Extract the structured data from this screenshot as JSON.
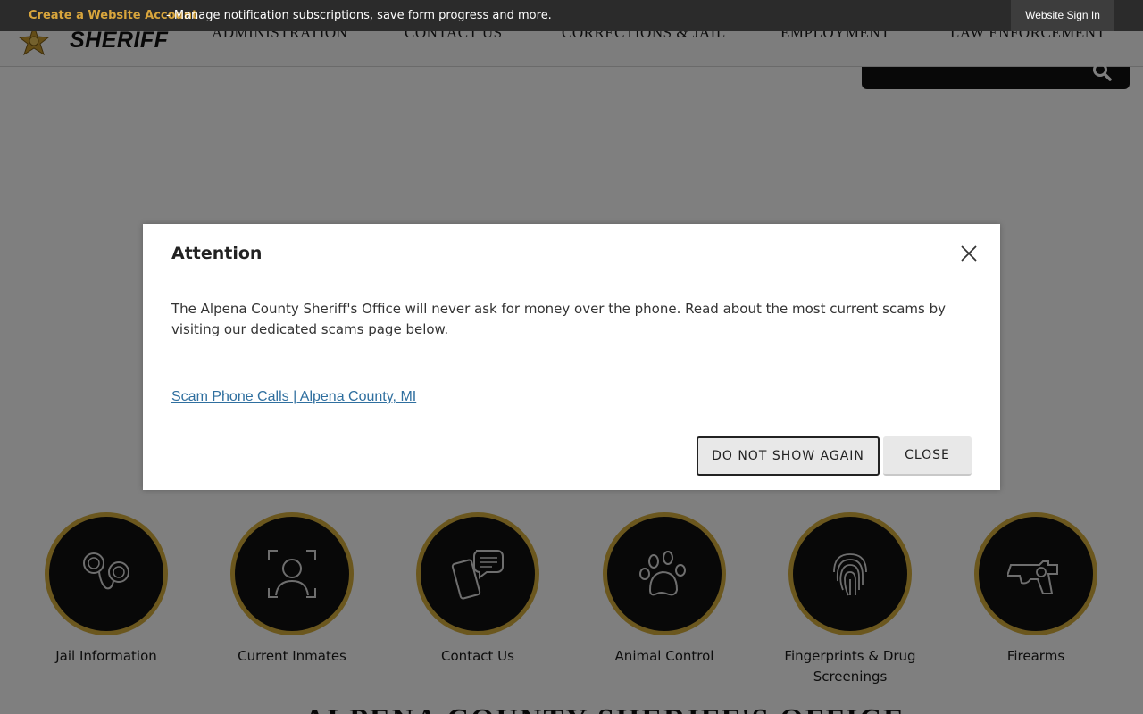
{
  "topbar": {
    "create_account": "Create a Website Account",
    "description": " - Manage notification subscriptions, save form progress and more.",
    "sign_in": "Website Sign In"
  },
  "header": {
    "logo_text": "SHERIFF",
    "nav": [
      "ADMINISTRATION",
      "CONTACT US",
      "CORRECTIONS & JAIL",
      "EMPLOYMENT",
      "LAW ENFORCEMENT"
    ]
  },
  "modal": {
    "title": "Attention",
    "body": "The Alpena County Sheriff's Office will never ask for money over the phone. Read about the most current scams by visiting our dedicated scams page below.",
    "link": "Scam Phone Calls | Alpena County, MI",
    "btn_dont_show": "DO NOT SHOW AGAIN",
    "btn_close": "CLOSE"
  },
  "quick_links": [
    {
      "label": "Jail Information",
      "icon": "handcuffs-icon"
    },
    {
      "label": "Current Inmates",
      "icon": "person-frame-icon"
    },
    {
      "label": "Contact Us",
      "icon": "phone-chat-icon"
    },
    {
      "label": "Animal Control",
      "icon": "paw-icon"
    },
    {
      "label": "Fingerprints & Drug Screenings",
      "icon": "fingerprint-icon"
    },
    {
      "label": "Firearms",
      "icon": "revolver-icon"
    }
  ],
  "page_heading": "ALPENA COUNTY SHERIFF'S OFFICE",
  "colors": {
    "accent_gold": "#d6ae3c",
    "link_blue": "#2f6f9f",
    "topbar_bg": "#2b2b2b"
  }
}
